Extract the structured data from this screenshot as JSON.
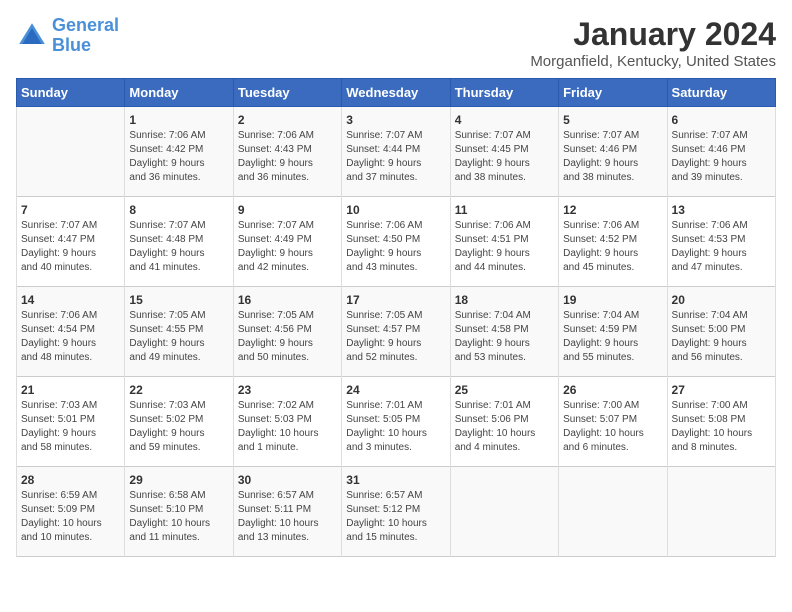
{
  "logo": {
    "line1": "General",
    "line2": "Blue"
  },
  "title": "January 2024",
  "subtitle": "Morganfield, Kentucky, United States",
  "weekdays": [
    "Sunday",
    "Monday",
    "Tuesday",
    "Wednesday",
    "Thursday",
    "Friday",
    "Saturday"
  ],
  "weeks": [
    [
      {
        "date": "",
        "info": ""
      },
      {
        "date": "1",
        "info": "Sunrise: 7:06 AM\nSunset: 4:42 PM\nDaylight: 9 hours\nand 36 minutes."
      },
      {
        "date": "2",
        "info": "Sunrise: 7:06 AM\nSunset: 4:43 PM\nDaylight: 9 hours\nand 36 minutes."
      },
      {
        "date": "3",
        "info": "Sunrise: 7:07 AM\nSunset: 4:44 PM\nDaylight: 9 hours\nand 37 minutes."
      },
      {
        "date": "4",
        "info": "Sunrise: 7:07 AM\nSunset: 4:45 PM\nDaylight: 9 hours\nand 38 minutes."
      },
      {
        "date": "5",
        "info": "Sunrise: 7:07 AM\nSunset: 4:46 PM\nDaylight: 9 hours\nand 38 minutes."
      },
      {
        "date": "6",
        "info": "Sunrise: 7:07 AM\nSunset: 4:46 PM\nDaylight: 9 hours\nand 39 minutes."
      }
    ],
    [
      {
        "date": "7",
        "info": "Sunrise: 7:07 AM\nSunset: 4:47 PM\nDaylight: 9 hours\nand 40 minutes."
      },
      {
        "date": "8",
        "info": "Sunrise: 7:07 AM\nSunset: 4:48 PM\nDaylight: 9 hours\nand 41 minutes."
      },
      {
        "date": "9",
        "info": "Sunrise: 7:07 AM\nSunset: 4:49 PM\nDaylight: 9 hours\nand 42 minutes."
      },
      {
        "date": "10",
        "info": "Sunrise: 7:06 AM\nSunset: 4:50 PM\nDaylight: 9 hours\nand 43 minutes."
      },
      {
        "date": "11",
        "info": "Sunrise: 7:06 AM\nSunset: 4:51 PM\nDaylight: 9 hours\nand 44 minutes."
      },
      {
        "date": "12",
        "info": "Sunrise: 7:06 AM\nSunset: 4:52 PM\nDaylight: 9 hours\nand 45 minutes."
      },
      {
        "date": "13",
        "info": "Sunrise: 7:06 AM\nSunset: 4:53 PM\nDaylight: 9 hours\nand 47 minutes."
      }
    ],
    [
      {
        "date": "14",
        "info": "Sunrise: 7:06 AM\nSunset: 4:54 PM\nDaylight: 9 hours\nand 48 minutes."
      },
      {
        "date": "15",
        "info": "Sunrise: 7:05 AM\nSunset: 4:55 PM\nDaylight: 9 hours\nand 49 minutes."
      },
      {
        "date": "16",
        "info": "Sunrise: 7:05 AM\nSunset: 4:56 PM\nDaylight: 9 hours\nand 50 minutes."
      },
      {
        "date": "17",
        "info": "Sunrise: 7:05 AM\nSunset: 4:57 PM\nDaylight: 9 hours\nand 52 minutes."
      },
      {
        "date": "18",
        "info": "Sunrise: 7:04 AM\nSunset: 4:58 PM\nDaylight: 9 hours\nand 53 minutes."
      },
      {
        "date": "19",
        "info": "Sunrise: 7:04 AM\nSunset: 4:59 PM\nDaylight: 9 hours\nand 55 minutes."
      },
      {
        "date": "20",
        "info": "Sunrise: 7:04 AM\nSunset: 5:00 PM\nDaylight: 9 hours\nand 56 minutes."
      }
    ],
    [
      {
        "date": "21",
        "info": "Sunrise: 7:03 AM\nSunset: 5:01 PM\nDaylight: 9 hours\nand 58 minutes."
      },
      {
        "date": "22",
        "info": "Sunrise: 7:03 AM\nSunset: 5:02 PM\nDaylight: 9 hours\nand 59 minutes."
      },
      {
        "date": "23",
        "info": "Sunrise: 7:02 AM\nSunset: 5:03 PM\nDaylight: 10 hours\nand 1 minute."
      },
      {
        "date": "24",
        "info": "Sunrise: 7:01 AM\nSunset: 5:05 PM\nDaylight: 10 hours\nand 3 minutes."
      },
      {
        "date": "25",
        "info": "Sunrise: 7:01 AM\nSunset: 5:06 PM\nDaylight: 10 hours\nand 4 minutes."
      },
      {
        "date": "26",
        "info": "Sunrise: 7:00 AM\nSunset: 5:07 PM\nDaylight: 10 hours\nand 6 minutes."
      },
      {
        "date": "27",
        "info": "Sunrise: 7:00 AM\nSunset: 5:08 PM\nDaylight: 10 hours\nand 8 minutes."
      }
    ],
    [
      {
        "date": "28",
        "info": "Sunrise: 6:59 AM\nSunset: 5:09 PM\nDaylight: 10 hours\nand 10 minutes."
      },
      {
        "date": "29",
        "info": "Sunrise: 6:58 AM\nSunset: 5:10 PM\nDaylight: 10 hours\nand 11 minutes."
      },
      {
        "date": "30",
        "info": "Sunrise: 6:57 AM\nSunset: 5:11 PM\nDaylight: 10 hours\nand 13 minutes."
      },
      {
        "date": "31",
        "info": "Sunrise: 6:57 AM\nSunset: 5:12 PM\nDaylight: 10 hours\nand 15 minutes."
      },
      {
        "date": "",
        "info": ""
      },
      {
        "date": "",
        "info": ""
      },
      {
        "date": "",
        "info": ""
      }
    ]
  ]
}
